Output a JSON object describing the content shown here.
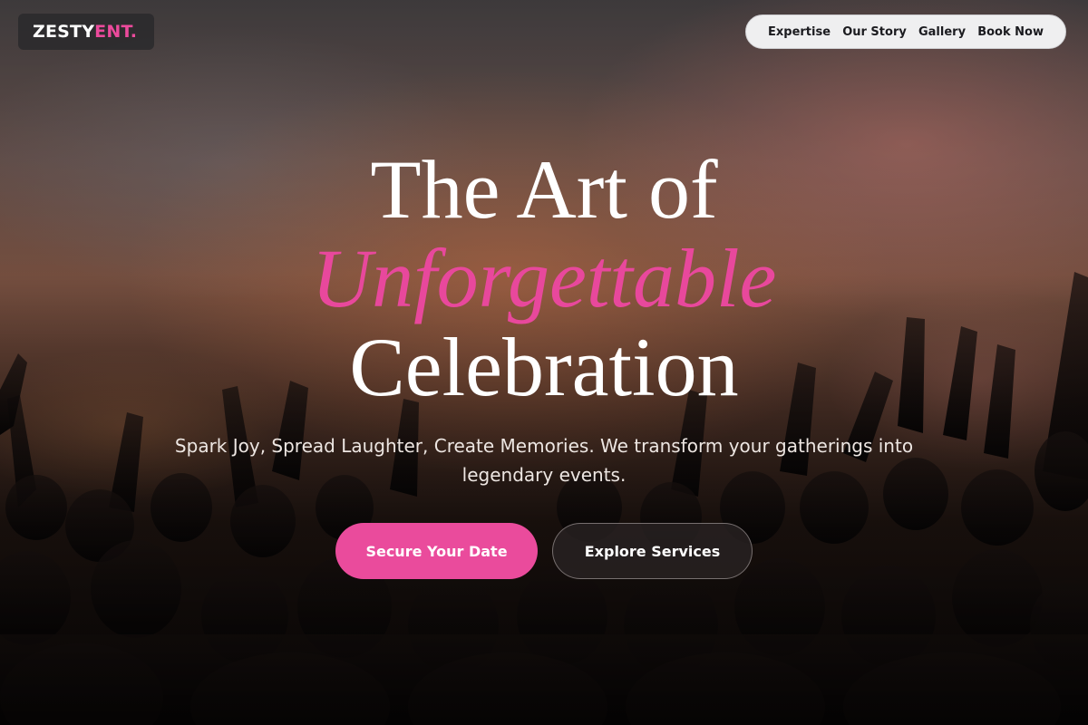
{
  "brand": {
    "logo_main": "ZESTY",
    "logo_accent": "ENT."
  },
  "nav": {
    "items": [
      {
        "label": "Expertise"
      },
      {
        "label": "Our Story"
      },
      {
        "label": "Gallery"
      },
      {
        "label": "Book Now"
      }
    ]
  },
  "hero": {
    "title_line1": "The Art of",
    "title_line2": "Unforgettable",
    "title_line3": "Celebration",
    "subtitle": "Spark Joy, Spread Laughter, Create Memories. We transform your gatherings into legendary events.",
    "primary_cta": "Secure Your Date",
    "secondary_cta": "Explore Services"
  },
  "colors": {
    "accent": "#e8489c",
    "nav_background": "#efeff0",
    "text": "#ffffff"
  }
}
